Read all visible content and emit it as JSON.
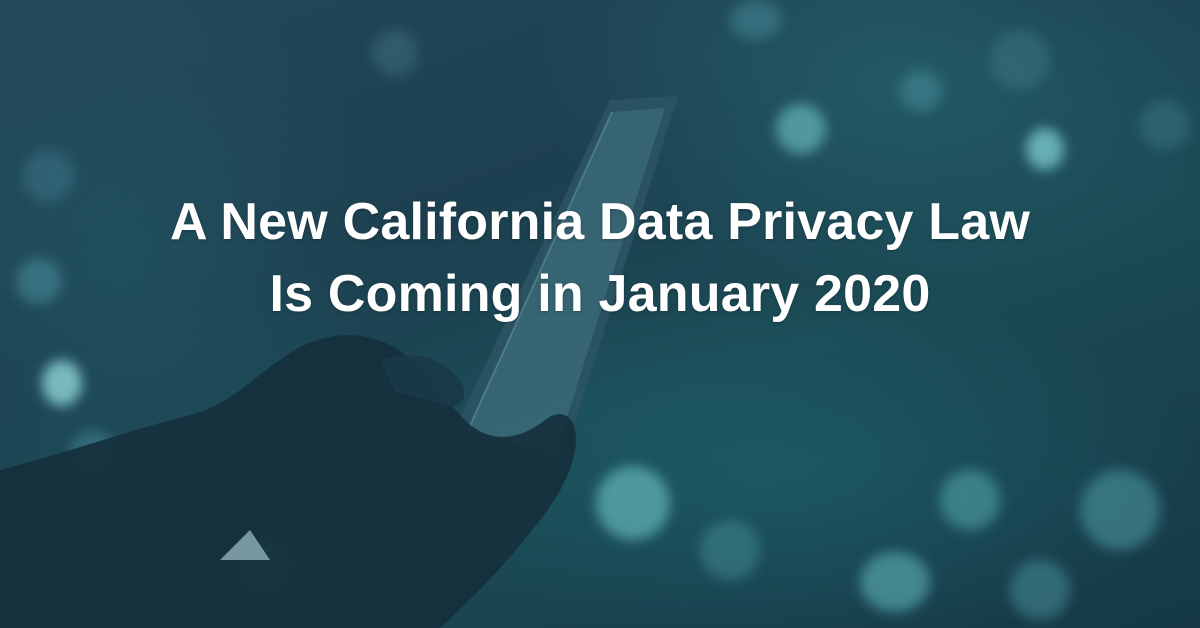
{
  "headline": {
    "line1": "A New California Data Privacy Law",
    "line2": "Is Coming in January 2020"
  },
  "background": {
    "description_icon": "hand-holding-smartphone",
    "tint": "#1e4a58"
  }
}
